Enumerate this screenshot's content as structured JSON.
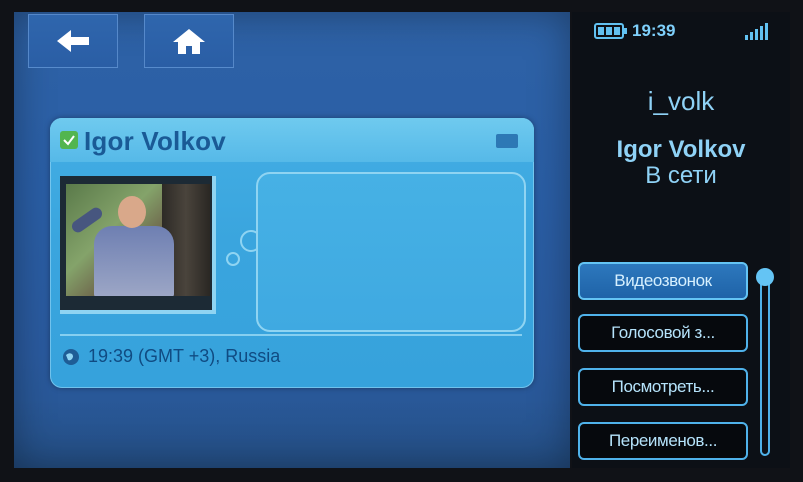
{
  "nav": {
    "back_icon": "arrow-left-icon",
    "home_icon": "home-icon"
  },
  "contact_card": {
    "status_icon": "online-check-icon",
    "name": "Igor Volkov",
    "video_icon": "video-camera-icon",
    "location_icon": "globe-icon",
    "location_text": "19:39 (GMT +3), Russia"
  },
  "statusbar": {
    "battery_icon": "battery-icon",
    "time": "19:39",
    "signal_icon": "signal-bars-icon"
  },
  "panel": {
    "username": "i_volk",
    "display_name": "Igor Volkov",
    "presence": "В сети"
  },
  "actions": [
    {
      "label": "Видеозвонок",
      "active": true
    },
    {
      "label": "Голосовой з...",
      "active": false
    },
    {
      "label": "Посмотреть...",
      "active": false
    },
    {
      "label": "Переименов...",
      "active": false
    }
  ],
  "colors": {
    "main_bg": "#2a5ea5",
    "card_bg": "#3aa5de",
    "accent": "#4fb2ea",
    "panel_bg": "#0c1016",
    "active_button": "#2d78bd"
  }
}
